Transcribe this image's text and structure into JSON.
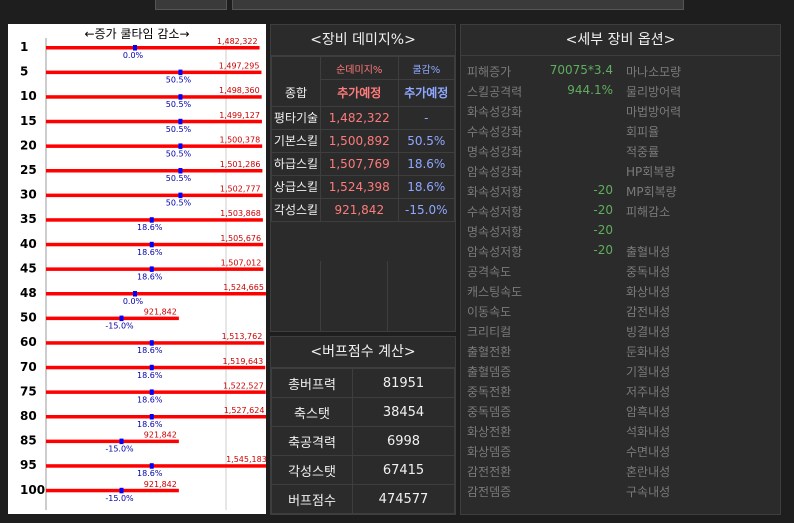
{
  "graph": {
    "header": "←증가  쿨타임  감소→",
    "rows": [
      {
        "level": "1",
        "value": "1,482,322",
        "reduction": "0.0%",
        "ratio": 0.905,
        "pct": 0.0
      },
      {
        "level": "5",
        "value": "1,497,295",
        "reduction": "50.5%",
        "ratio": 0.913,
        "pct": 50.5
      },
      {
        "level": "10",
        "value": "1,498,360",
        "reduction": "50.5%",
        "ratio": 0.914,
        "pct": 50.5
      },
      {
        "level": "15",
        "value": "1,499,127",
        "reduction": "50.5%",
        "ratio": 0.915,
        "pct": 50.5
      },
      {
        "level": "20",
        "value": "1,500,378",
        "reduction": "50.5%",
        "ratio": 0.916,
        "pct": 50.5
      },
      {
        "level": "25",
        "value": "1,501,286",
        "reduction": "50.5%",
        "ratio": 0.917,
        "pct": 50.5
      },
      {
        "level": "30",
        "value": "1,502,777",
        "reduction": "50.5%",
        "ratio": 0.918,
        "pct": 50.5
      },
      {
        "level": "35",
        "value": "1,503,868",
        "reduction": "18.6%",
        "ratio": 0.919,
        "pct": 18.6
      },
      {
        "level": "40",
        "value": "1,505,676",
        "reduction": "18.6%",
        "ratio": 0.92,
        "pct": 18.6
      },
      {
        "level": "45",
        "value": "1,507,012",
        "reduction": "18.6%",
        "ratio": 0.921,
        "pct": 18.6
      },
      {
        "level": "48",
        "value": "1,524,665",
        "reduction": "0.0%",
        "ratio": 0.932,
        "pct": 0.0
      },
      {
        "level": "50",
        "value": "921,842",
        "reduction": "-15.0%",
        "ratio": 0.563,
        "pct": -15.0
      },
      {
        "level": "60",
        "value": "1,513,762",
        "reduction": "18.6%",
        "ratio": 0.925,
        "pct": 18.6
      },
      {
        "level": "70",
        "value": "1,519,643",
        "reduction": "18.6%",
        "ratio": 0.929,
        "pct": 18.6
      },
      {
        "level": "75",
        "value": "1,522,527",
        "reduction": "18.6%",
        "ratio": 0.931,
        "pct": 18.6
      },
      {
        "level": "80",
        "value": "1,527,624",
        "reduction": "18.6%",
        "ratio": 0.934,
        "pct": 18.6
      },
      {
        "level": "85",
        "value": "921,842",
        "reduction": "-15.0%",
        "ratio": 0.563,
        "pct": -15.0
      },
      {
        "level": "95",
        "value": "1,545,183",
        "reduction": "18.6%",
        "ratio": 0.944,
        "pct": 18.6
      },
      {
        "level": "100",
        "value": "921,842",
        "reduction": "-15.0%",
        "ratio": 0.563,
        "pct": -15.0
      }
    ]
  },
  "damage": {
    "title": "<장비 데미지%>",
    "col1_header": "순데미지%",
    "col2_header": "쿨감%",
    "summary_label": "종합",
    "summary_col1": "추가예정",
    "summary_col2": "추가예정",
    "rows": [
      {
        "label": "평타기술",
        "dmg": "1,482,322",
        "cd": "-"
      },
      {
        "label": "기본스킬",
        "dmg": "1,500,892",
        "cd": "50.5%"
      },
      {
        "label": "하급스킬",
        "dmg": "1,507,769",
        "cd": "18.6%"
      },
      {
        "label": "상급스킬",
        "dmg": "1,524,398",
        "cd": "18.6%"
      },
      {
        "label": "각성스킬",
        "dmg": "921,842",
        "cd": "-15.0%"
      }
    ]
  },
  "buff": {
    "title": "<버프점수 계산>",
    "rows": [
      {
        "label": "총버프력",
        "value": "81951"
      },
      {
        "label": "축스탯",
        "value": "38454"
      },
      {
        "label": "축공격력",
        "value": "6998"
      },
      {
        "label": "각성스탯",
        "value": "67415"
      },
      {
        "label": "버프점수",
        "value": "474577"
      }
    ]
  },
  "options": {
    "title": "<세부 장비 옵션>",
    "rows": [
      {
        "n1": "피해증가",
        "v1": "70075*3.4",
        "n2": "마나소모량"
      },
      {
        "n1": "스킬공격력",
        "v1": "944.1%",
        "n2": "물리방어력"
      },
      {
        "n1": "화속성강화",
        "v1": "",
        "n2": "마법방어력"
      },
      {
        "n1": "수속성강화",
        "v1": "",
        "n2": "회피율"
      },
      {
        "n1": "명속성강화",
        "v1": "",
        "n2": "적중률"
      },
      {
        "n1": "암속성강화",
        "v1": "",
        "n2": "HP회복량"
      },
      {
        "n1": "화속성저항",
        "v1": "-20",
        "n2": "MP회복량"
      },
      {
        "n1": "수속성저항",
        "v1": "-20",
        "n2": "피해감소"
      },
      {
        "n1": "명속성저항",
        "v1": "-20",
        "n2": ""
      },
      {
        "n1": "암속성저항",
        "v1": "-20",
        "n2": "출혈내성"
      },
      {
        "n1": "공격속도",
        "v1": "",
        "n2": "중독내성"
      },
      {
        "n1": "캐스팅속도",
        "v1": "",
        "n2": "화상내성"
      },
      {
        "n1": "이동속도",
        "v1": "",
        "n2": "감전내성"
      },
      {
        "n1": "크리티컬",
        "v1": "",
        "n2": "빙결내성"
      },
      {
        "n1": "출혈전환",
        "v1": "",
        "n2": "둔화내성"
      },
      {
        "n1": "출혈뎀증",
        "v1": "",
        "n2": "기절내성"
      },
      {
        "n1": "중독전환",
        "v1": "",
        "n2": "저주내성"
      },
      {
        "n1": "중독뎀증",
        "v1": "",
        "n2": "암흑내성"
      },
      {
        "n1": "화상전환",
        "v1": "",
        "n2": "석화내성"
      },
      {
        "n1": "화상뎀증",
        "v1": "",
        "n2": "수면내성"
      },
      {
        "n1": "감전전환",
        "v1": "",
        "n2": "혼란내성"
      },
      {
        "n1": "감전뎀증",
        "v1": "",
        "n2": "구속내성"
      }
    ]
  }
}
